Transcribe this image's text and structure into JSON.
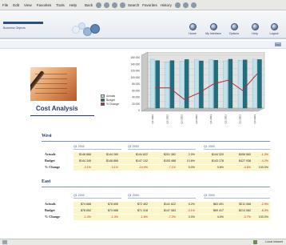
{
  "menubar": {
    "items": [
      "File",
      "Edit",
      "View",
      "Favorites",
      "Tools",
      "Help"
    ],
    "toolbar": [
      "Back",
      "Search",
      "Favorites",
      "History"
    ]
  },
  "banner": {
    "logo_text": "Business Objects",
    "nav": [
      {
        "label": "Home",
        "icon": "home-icon"
      },
      {
        "label": "My Interface",
        "icon": "interface-icon"
      },
      {
        "label": "Options",
        "icon": "options-icon"
      },
      {
        "label": "Help",
        "icon": "help-icon"
      },
      {
        "label": "Logout",
        "icon": "logout-icon"
      }
    ]
  },
  "subbar": {
    "icon": "print-icon",
    "label": "PDF"
  },
  "report": {
    "title": "Cost Analysis",
    "legend": [
      {
        "label": "Actuals",
        "color": "#bfe3ee"
      },
      {
        "label": "Budget",
        "color": "#1f6f80"
      },
      {
        "label": "% Change",
        "color": "#b03030"
      }
    ]
  },
  "chart_data": {
    "type": "bar",
    "categories": [
      "Q1 2002",
      "Q2 2002",
      "Q3 2002",
      "Q4 2002",
      "Q1 2003",
      "Q2 2003",
      "Q3 2003",
      "Q4 2003"
    ],
    "series": [
      {
        "name": "Actuals",
        "values": [
          148,
          140,
          142,
          146,
          147,
          143,
          145,
          148
        ]
      },
      {
        "name": "Budget",
        "values": [
          144,
          144,
          147,
          143,
          145,
          148,
          146,
          147
        ]
      },
      {
        "name": "% Change",
        "values": [
          -3,
          -3,
          -12,
          -7,
          0,
          3,
          -5,
          8
        ]
      }
    ],
    "yticks": [
      "160 000",
      "140 000",
      "120 000",
      "100 000",
      "80 000",
      "60 000",
      "40 000",
      "20 000",
      "0"
    ],
    "ylim": [
      0,
      160
    ]
  },
  "sections": [
    {
      "name": "West",
      "quarters": [
        "Q1 2002",
        "Q1 2003",
        "Q1 2003"
      ],
      "rows": [
        {
          "label": "Actuals",
          "values": [
            "$148 866",
            "$144 260",
            "$144 822",
            "$201 382",
            "2.0%",
            "$144 320",
            "$406 560",
            "-1.3%"
          ]
        },
        {
          "label": "Budget",
          "values": [
            "$144 349",
            "$148 866",
            "$147 132",
            "$153 488",
            "10.6%",
            "$143 178",
            "$427 938",
            "-4.2%"
          ]
        },
        {
          "label": "% Change",
          "values": [
            "-3.1%",
            "-3.1%",
            "-10.0%",
            "-7.1%",
            "0.0%",
            "0.6%",
            "-4.6%",
            "100.0%"
          ]
        }
      ]
    },
    {
      "name": "East",
      "quarters": [
        "Q1 2002",
        "Q1 2003",
        "Q1 2003"
      ],
      "rows": [
        {
          "label": "Actuals",
          "values": [
            "$74 688",
            "$78 655",
            "$72 402",
            "$141 622",
            "5.2%",
            "$63 491",
            "$211 068",
            "-2.9%"
          ]
        },
        {
          "label": "Budget",
          "values": [
            "$78 652",
            "$74 688",
            "$71 318",
            "$147 083",
            "-3.1%",
            "$69 417",
            "$213 082",
            "-8.3%"
          ]
        },
        {
          "label": "% Change",
          "values": [
            "-1.4%",
            "-1.4%",
            "-1.8%",
            "-7.2%",
            "0.0%",
            "4.0%",
            "-3.7%",
            "100.0%"
          ]
        }
      ]
    }
  ],
  "status": {
    "zone": "Local intranet"
  }
}
